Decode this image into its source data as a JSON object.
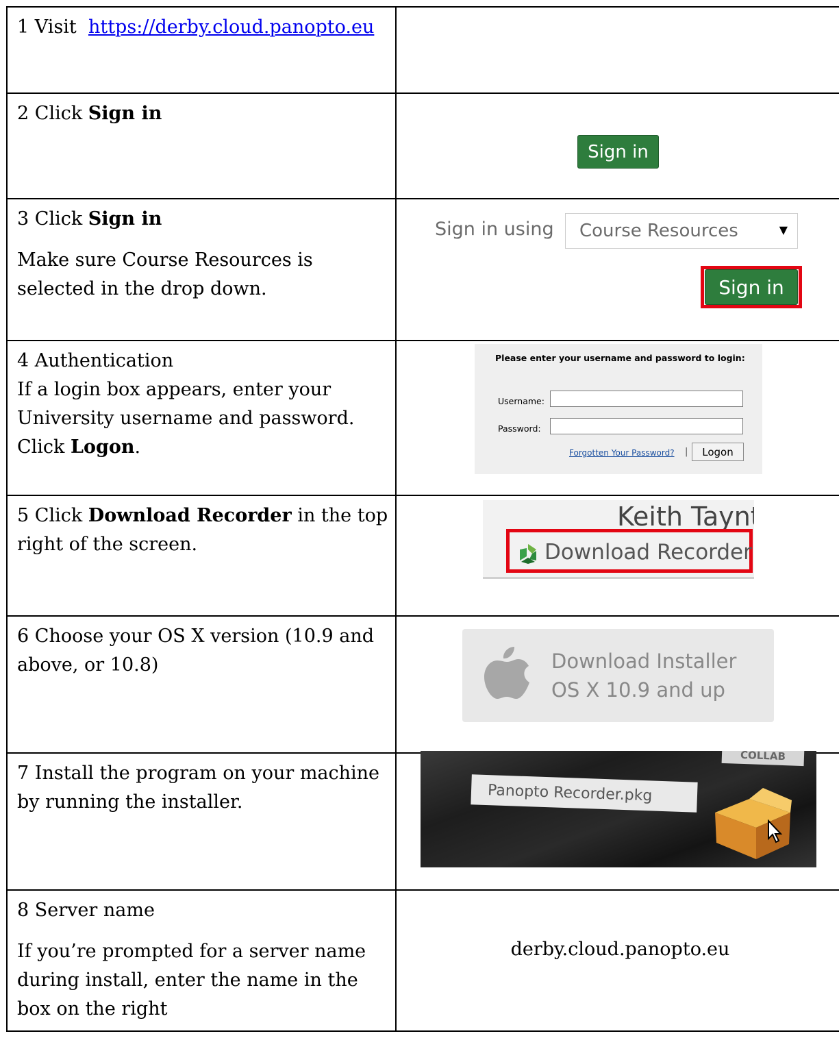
{
  "steps": [
    {
      "num": "1",
      "text": "Visit",
      "link": "https://derby.cloud.panopto.eu"
    },
    {
      "num": "2",
      "text": "Click",
      "bold": "Sign in"
    },
    {
      "num": "3",
      "text": "Click",
      "bold": "Sign in",
      "note": "Make sure Course Resources is selected in the drop down."
    },
    {
      "num": "4",
      "title": "Authentication",
      "text": "If a login box appears, enter your University username and password.",
      "click": "Click",
      "bold": "Logon",
      "after": "."
    },
    {
      "num": "5",
      "text": "Click",
      "bold": "Download Recorder",
      "after": "in the top right of the screen."
    },
    {
      "num": "6",
      "text": "Choose your OS X version (10.9 and above, or 10.8)"
    },
    {
      "num": "7",
      "text": "Install the program on your machine by running the installer."
    },
    {
      "num": "8",
      "title": "Server name",
      "text": "If you’re prompted for a server name during install, enter the name in the box on the right"
    }
  ],
  "shots": {
    "signin_button": "Sign in",
    "sign_in_using": "Sign in using",
    "provider_selected": "Course Resources",
    "login_title": "Please enter your username and password to login:",
    "username_label": "Username:",
    "password_label": "Password:",
    "forgot_link": "Forgotten Your Password?",
    "pipe": "|",
    "logon_button": "Logon",
    "user_name_partial": "Keith Taynt",
    "download_recorder": "Download Recorder",
    "installer_line1": "Download Installer",
    "installer_line2": "OS X 10.9 and up",
    "pkg_name": "Panopto Recorder.pkg",
    "collab": "COLLAB",
    "server_name": "derby.cloud.panopto.eu"
  },
  "colors": {
    "green_button": "#2e7d3d",
    "red_highlight": "#e30613",
    "link": "#0000ee"
  }
}
